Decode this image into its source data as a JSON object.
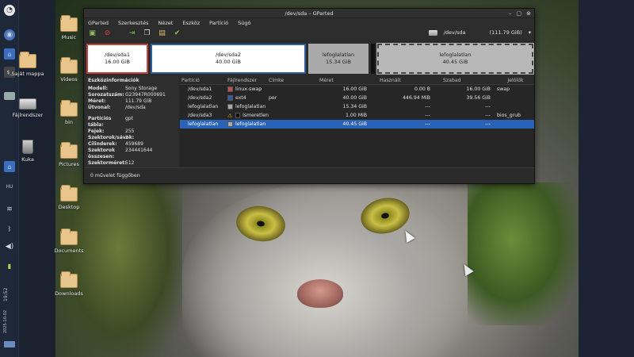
{
  "window": {
    "title": "/dev/sda – GParted",
    "menu": [
      "GParted",
      "Szerkesztés",
      "Nézet",
      "Eszköz",
      "Partíció",
      "Súgó"
    ],
    "device": "/dev/sda",
    "device_size": "(111.79 GiB)"
  },
  "disk_map": {
    "sda1": {
      "name": "/dev/sda1",
      "size": "16.00 GiB"
    },
    "sda2": {
      "name": "/dev/sda2",
      "size": "40.00 GiB"
    },
    "unall1": {
      "name": "lefoglalatlan",
      "size": "15.34 GiB"
    },
    "unall2": {
      "name": "lefoglalatlan",
      "size": "40.45 GiB"
    }
  },
  "device_info": {
    "heading": "Eszközinformációk",
    "model_k": "Modell:",
    "model_v": "Sony Storage",
    "serial_k": "Sorozatszám:",
    "serial_v": "G23947R000691",
    "size_k": "Méret:",
    "size_v": "111.79 GiB",
    "path_k": "Útvonal:",
    "path_v": "/dev/sda",
    "pt_k": "Partíciós tábla:",
    "pt_v": "gpt",
    "heads_k": "Fejek:",
    "heads_v": "255",
    "spt_k": "Szektorok/sávok:",
    "spt_v": "2",
    "cyl_k": "Cilinderek:",
    "cyl_v": "459689",
    "total_k": "Szektorok összesen:",
    "total_v": "234441644",
    "ss_k": "Szektorméret:",
    "ss_v": "512"
  },
  "table": {
    "headers": [
      "Partíció",
      "Fájlrendszer",
      "Címke",
      "Méret",
      "Használt",
      "Szabad",
      "Jelölők"
    ],
    "rows": [
      {
        "partition": "/dev/sda1",
        "fs": "linux-swap",
        "fs_color": "#c0504d",
        "label": "",
        "size": "16.00 GiB",
        "used": "0.00 B",
        "free": "16.00 GiB",
        "flags": "swap",
        "warn": false
      },
      {
        "partition": "/dev/sda2",
        "fs": "ext4",
        "fs_color": "#2f5f9e",
        "label": "per",
        "size": "40.00 GiB",
        "used": "446.94 MiB",
        "free": "39.56 GiB",
        "flags": "",
        "warn": false
      },
      {
        "partition": "lefoglalatlan",
        "fs": "lefoglalatlan",
        "fs_color": "#a9a9a9",
        "label": "",
        "size": "15.34 GiB",
        "used": "---",
        "free": "---",
        "flags": "",
        "warn": false
      },
      {
        "partition": "/dev/sda3",
        "fs": "ismeretlen",
        "fs_color": "#111111",
        "label": "",
        "size": "1.00 MiB",
        "used": "---",
        "free": "---",
        "flags": "bios_grub",
        "warn": true
      },
      {
        "partition": "lefoglalatlan",
        "fs": "lefoglalatlan",
        "fs_color": "#a9a9a9",
        "label": "",
        "size": "40.45 GiB",
        "used": "---",
        "free": "---",
        "flags": "",
        "warn": false
      }
    ]
  },
  "status": "0 művelet függőben",
  "desktop": {
    "icons": [
      "Music",
      "Videos",
      "bin",
      "Pictures",
      "Desktop",
      "Documents",
      "Downloads"
    ],
    "left_icons": [
      "Saját mappa",
      "Fájlrendszer",
      "Kuka"
    ]
  },
  "panel": {
    "lang": "HU",
    "time": "19:52",
    "date": "2025-10-02"
  }
}
